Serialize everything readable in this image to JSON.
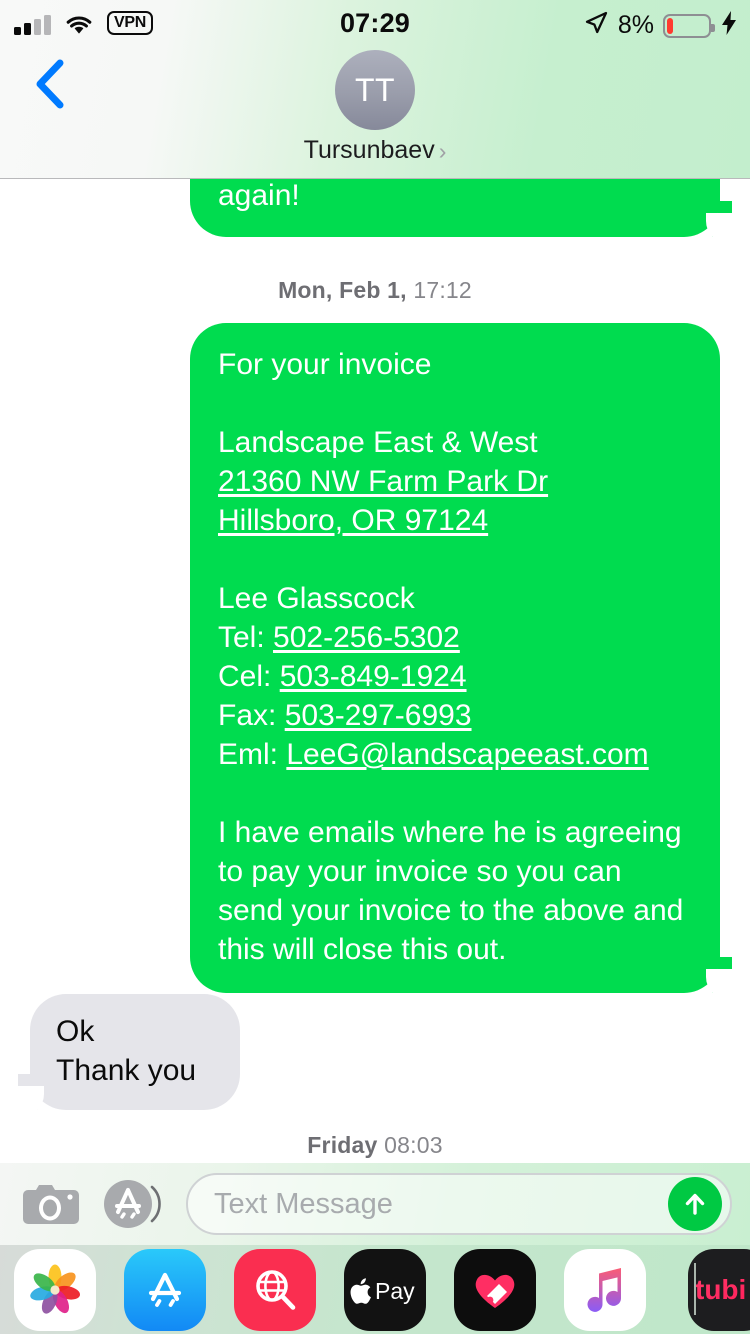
{
  "status_bar": {
    "time": "07:29",
    "vpn_label": "VPN",
    "battery_percent": "8%",
    "battery_level": 8,
    "charging": true,
    "location_active": true,
    "signal_bars_filled": 2,
    "signal_bars_total": 4,
    "wifi": "wifi-icon"
  },
  "nav": {
    "back_icon": "chevron-left-icon",
    "avatar_initials": "TT",
    "contact_name": "Tursunbaev",
    "detail_chevron": "chevron-right-icon"
  },
  "conversation": {
    "messages": [
      {
        "id": "msg-partial",
        "direction": "outgoing",
        "text": "again!",
        "clipped": true
      },
      {
        "id": "ts-feb1",
        "type": "timestamp",
        "day": "Mon, Feb 1,",
        "time": "17:12"
      },
      {
        "id": "msg-invoice",
        "direction": "outgoing",
        "line_intro": "For your invoice",
        "company": "Landscape East & West",
        "address_line1": "21360 NW Farm Park Dr",
        "address_line2": "Hillsboro, OR 97124",
        "contact_person": "Lee Glasscock",
        "tel_label": "Tel:",
        "tel_value": "502-256-5302",
        "cel_label": "Cel:",
        "cel_value": "503-849-1924",
        "fax_label": "Fax:",
        "fax_value": "503-297-6993",
        "eml_label": "Eml:",
        "eml_value": "LeeG@landscapeeast.com",
        "closing": "I have emails where he is agreeing to pay your invoice so you can send your invoice to the above and this will close this out."
      },
      {
        "id": "msg-ok",
        "direction": "incoming",
        "line1": "Ok",
        "line2": "Thank you"
      },
      {
        "id": "ts-friday",
        "type": "timestamp",
        "day": "Friday",
        "time": "08:03"
      }
    ]
  },
  "input_bar": {
    "camera_icon": "camera-icon",
    "appstore_icon": "app-store-icon",
    "placeholder": "Text Message",
    "value": "",
    "send_icon": "arrow-up-icon"
  },
  "app_drawer": {
    "apps": [
      {
        "name": "photos-app",
        "label": "Photos"
      },
      {
        "name": "app-store-app",
        "label": "App Store"
      },
      {
        "name": "images-search-app",
        "label": "#images"
      },
      {
        "name": "apple-pay-app",
        "label": "Apple Pay"
      },
      {
        "name": "digital-touch-app",
        "label": "Digital Touch"
      },
      {
        "name": "music-app",
        "label": "Music"
      },
      {
        "name": "tubi-app",
        "label": "tubi"
      }
    ]
  },
  "colors": {
    "outgoing_bubble": "#00dc4f",
    "incoming_bubble": "#e5e5ea",
    "accent_blue": "#007aff",
    "send_button": "#00c943",
    "timestamp_text": "#86868b"
  }
}
